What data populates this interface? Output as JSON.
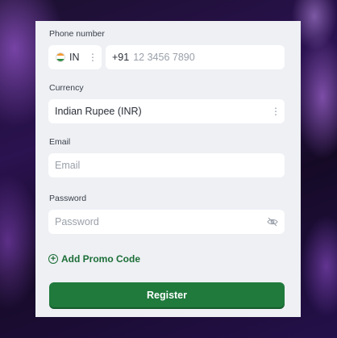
{
  "form": {
    "phone": {
      "label": "Phone number",
      "country_code": "IN",
      "dial_code": "+91",
      "placeholder": "12 3456 7890"
    },
    "currency": {
      "label": "Currency",
      "value": "Indian Rupee (INR)"
    },
    "email": {
      "label": "Email",
      "placeholder": "Email"
    },
    "password": {
      "label": "Password",
      "placeholder": "Password"
    },
    "promo_label": "Add Promo Code",
    "register_label": "Register"
  },
  "colors": {
    "accent_green": "#1f7a3c",
    "panel_bg": "#eef0f4"
  }
}
